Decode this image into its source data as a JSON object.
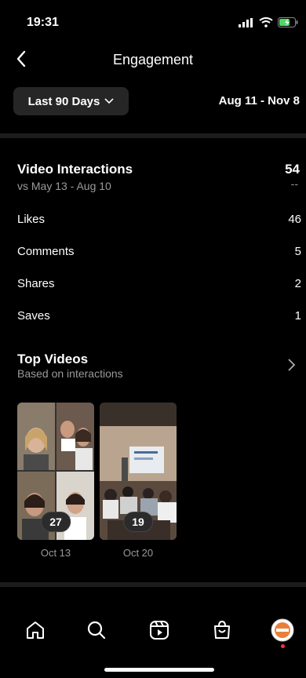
{
  "status_bar": {
    "time": "19:31"
  },
  "header": {
    "title": "Engagement"
  },
  "filter": {
    "label": "Last 90 Days",
    "date_range": "Aug 11 - Nov 8"
  },
  "video_interactions": {
    "title": "Video Interactions",
    "comparison": "vs May 13 - Aug 10",
    "total": "54",
    "change": "--",
    "metrics": [
      {
        "label": "Likes",
        "value": "46"
      },
      {
        "label": "Comments",
        "value": "5"
      },
      {
        "label": "Shares",
        "value": "2"
      },
      {
        "label": "Saves",
        "value": "1"
      }
    ]
  },
  "top_videos": {
    "title": "Top Videos",
    "subtitle": "Based on interactions",
    "items": [
      {
        "count": "27",
        "date": "Oct 13"
      },
      {
        "count": "19",
        "date": "Oct 20"
      }
    ]
  },
  "colors": {
    "background": "#000000",
    "secondary_text": "#9a9a9a",
    "notification_dot": "#ff3040"
  },
  "icons": [
    "back-arrow-icon",
    "chevron-down-icon",
    "chevron-right-icon",
    "home-icon",
    "search-icon",
    "reels-icon",
    "shop-icon",
    "profile-avatar"
  ]
}
